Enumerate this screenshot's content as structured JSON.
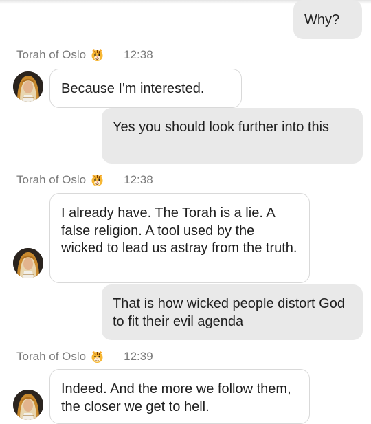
{
  "contact": {
    "name": "Torah of Oslo",
    "badge_icon": "tiger-face-icon"
  },
  "messages": [
    {
      "direction": "outgoing",
      "text": "Why?"
    },
    {
      "direction": "incoming",
      "sender": "Torah of Oslo",
      "time": "12:38",
      "text": "Because I'm interested."
    },
    {
      "direction": "outgoing",
      "text": "Yes you should look further into this"
    },
    {
      "direction": "incoming",
      "sender": "Torah of Oslo",
      "time": "12:38",
      "text": "I already have. The Torah is a lie. A false religion. A tool used by the wicked to lead us astray from the truth."
    },
    {
      "direction": "outgoing",
      "text": "That is how wicked people distort God to fit their evil agenda"
    },
    {
      "direction": "incoming",
      "sender": "Torah of Oslo",
      "time": "12:39",
      "text": "Indeed. And the more we follow them, the closer we get to hell."
    }
  ],
  "colors": {
    "outgoing_bubble": "#e9e9e9",
    "incoming_bubble": "#ffffff",
    "incoming_border": "#d9d9d9",
    "meta_text": "#7a7a7a"
  }
}
